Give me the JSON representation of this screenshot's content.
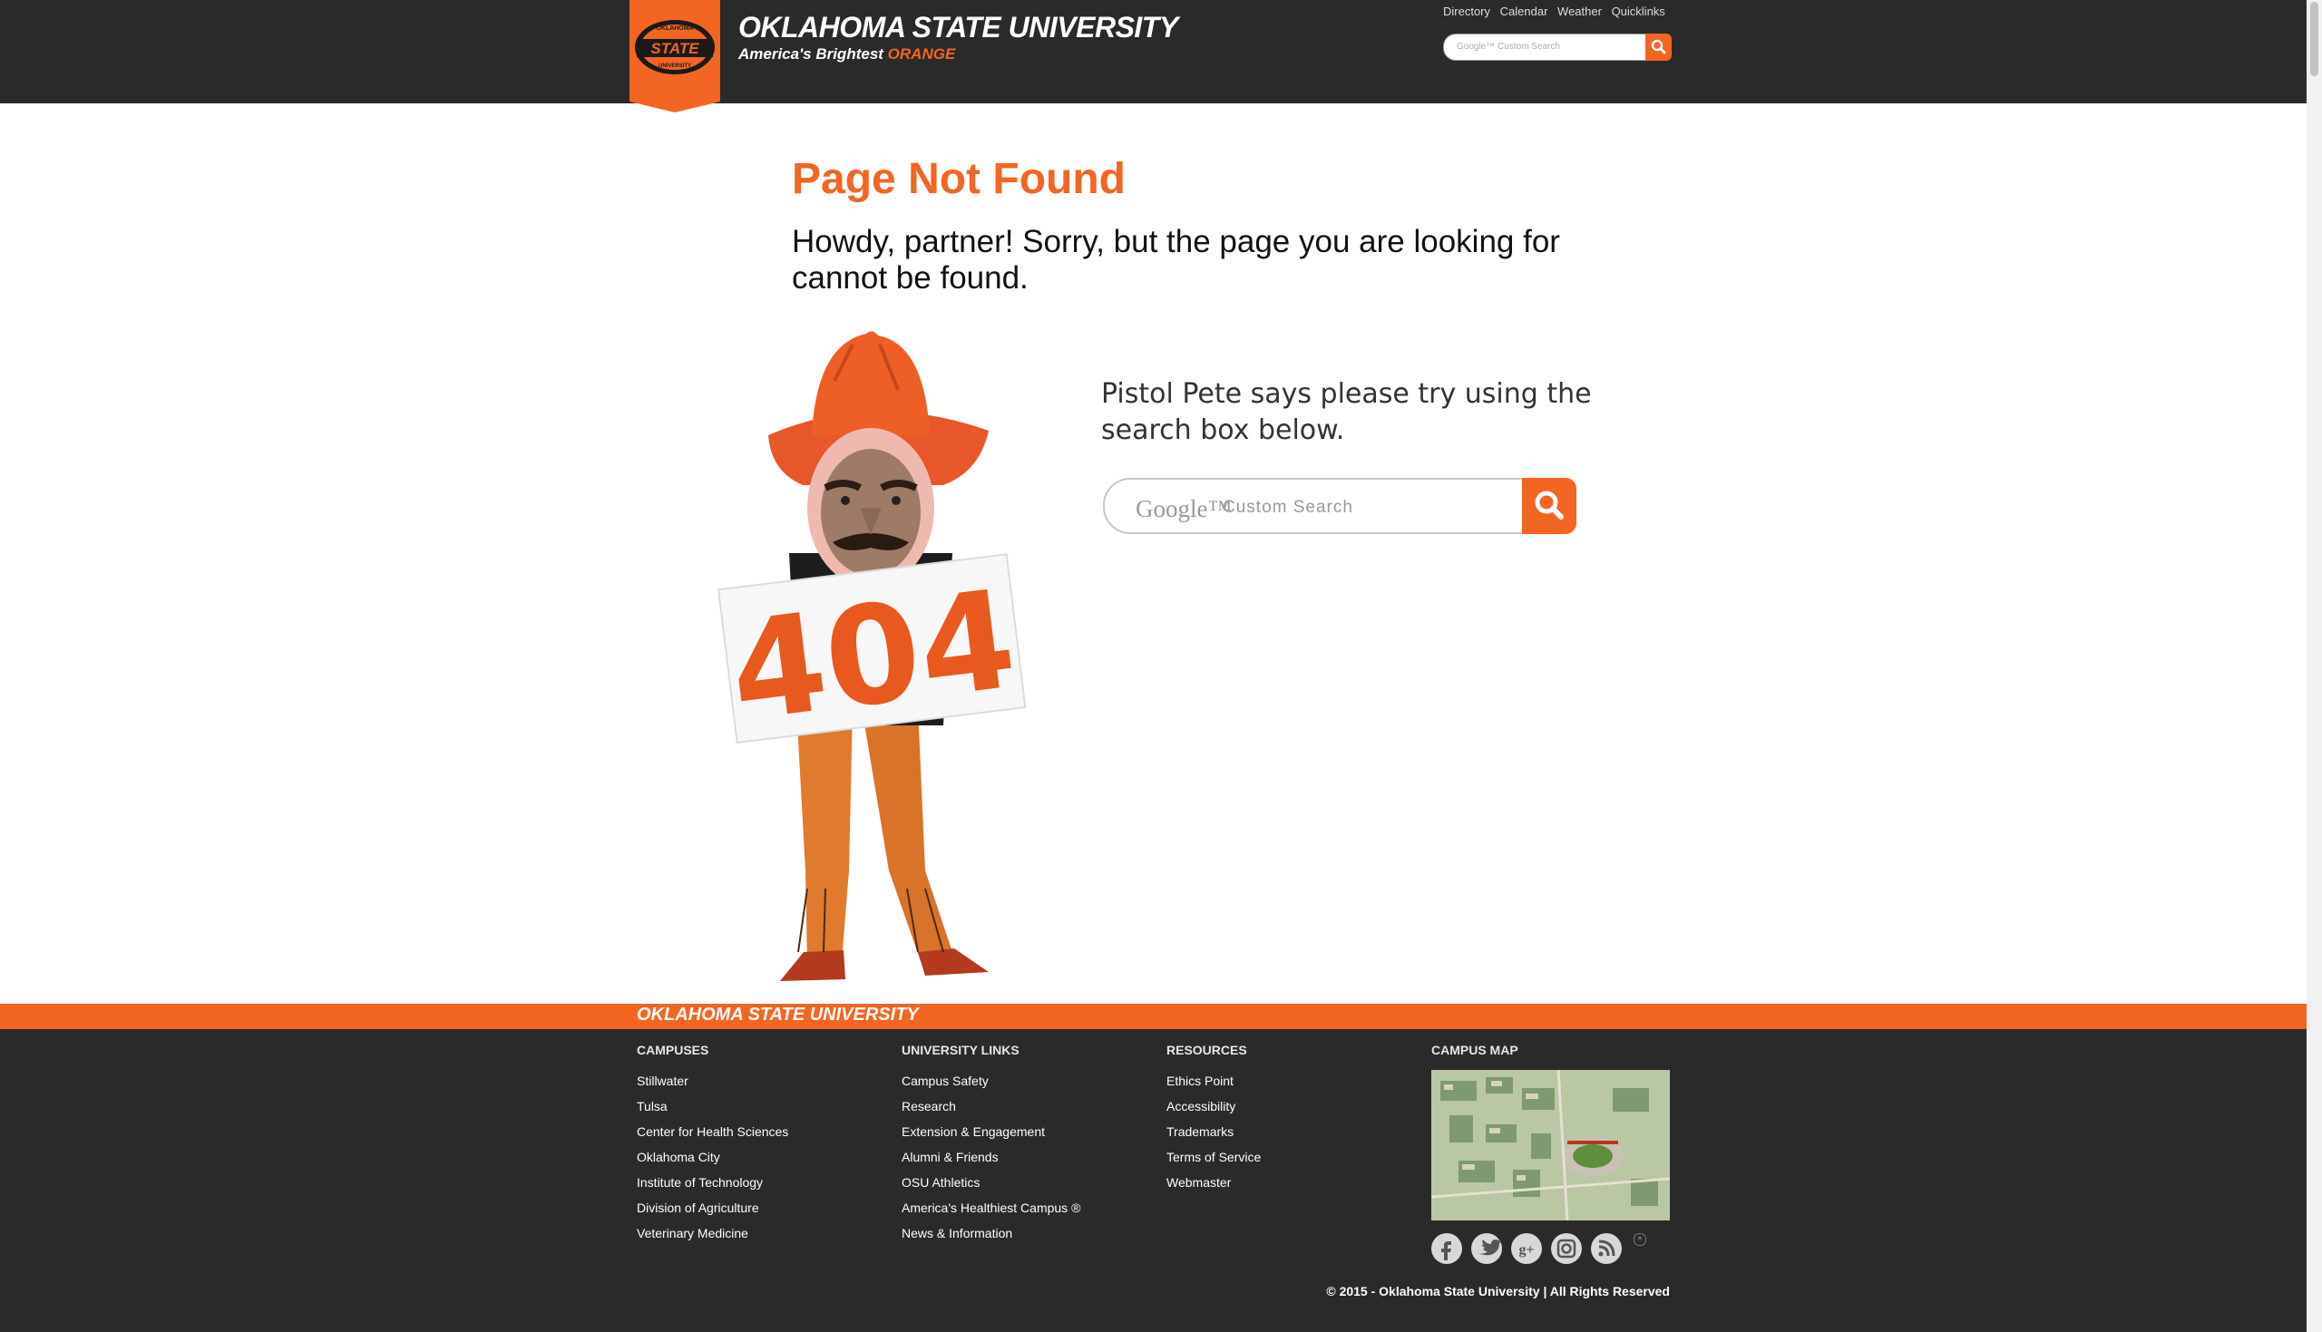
{
  "header": {
    "logo_text": [
      "OKLAHOMA",
      "STATE",
      "UNIVERSITY"
    ],
    "site_title": "OKLAHOMA STATE UNIVERSITY",
    "tagline_prefix": "America's Brightest",
    "tagline_highlight": "ORANGE",
    "top_links": [
      "Directory",
      "Calendar",
      "Weather",
      "Quicklinks"
    ],
    "search_placeholder": "Google™ Custom Search"
  },
  "main": {
    "title": "Page Not Found",
    "lead": "Howdy, partner! Sorry, but the page you are looking for cannot be found.",
    "sign_text": "404",
    "mascot_message": "Pistol Pete says please try using the search box below.",
    "search_google": "Google™",
    "search_custom": "Custom Search"
  },
  "footer": {
    "brand": "OKLAHOMA STATE UNIVERSITY",
    "columns": [
      {
        "heading": "CAMPUSES",
        "items": [
          "Stillwater",
          "Tulsa",
          "Center for Health Sciences",
          "Oklahoma City",
          "Institute of Technology",
          "Division of Agriculture",
          "Veterinary Medicine"
        ]
      },
      {
        "heading": "UNIVERSITY LINKS",
        "items": [
          "Campus Safety",
          "Research",
          "Extension & Engagement",
          "Alumni & Friends",
          "OSU Athletics",
          "America's Healthiest Campus ®",
          "News & Information"
        ]
      },
      {
        "heading": "RESOURCES",
        "items": [
          "Ethics Point",
          "Accessibility",
          "Trademarks",
          "Terms of Service",
          "Webmaster"
        ]
      }
    ],
    "map_heading": "CAMPUS MAP",
    "social_icons": [
      "facebook-icon",
      "twitter-icon",
      "google-plus-icon",
      "instagram-icon",
      "rss-icon"
    ],
    "copyright": "© 2015 - Oklahoma State University  |  All Rights Reserved"
  },
  "colors": {
    "accent": "#f26522",
    "header_bg": "#2a2a2a"
  }
}
